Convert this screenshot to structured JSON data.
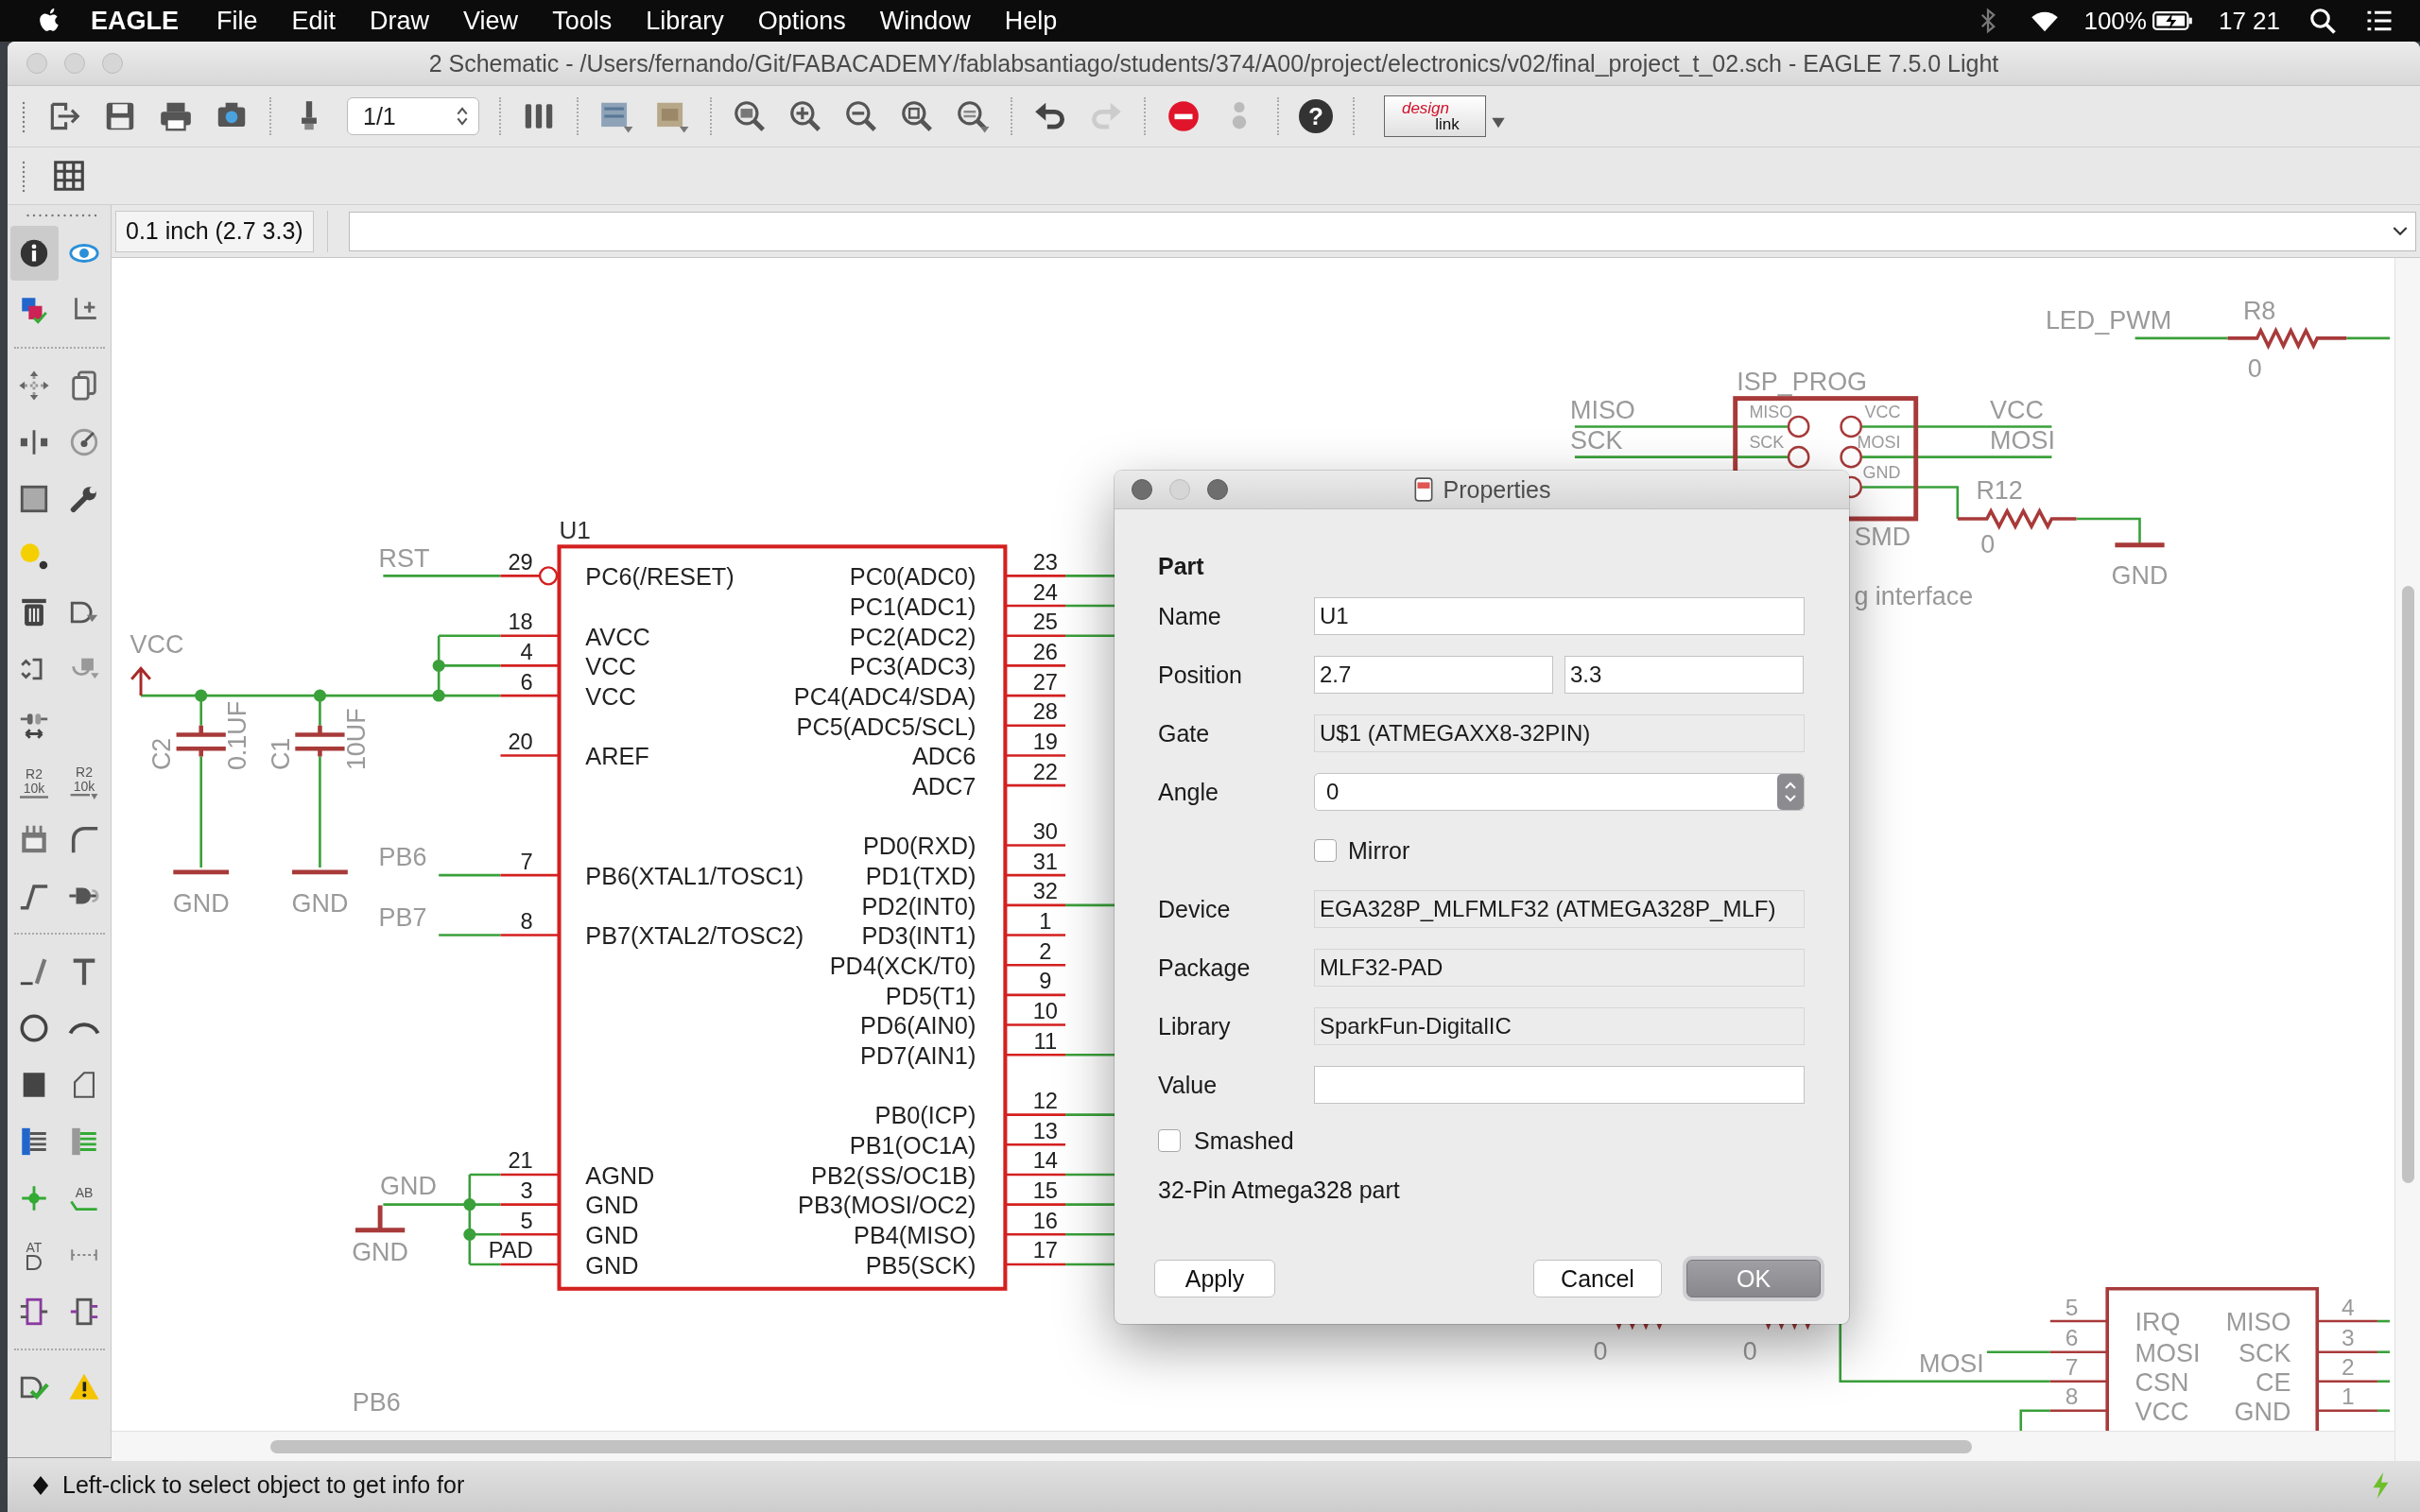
{
  "menu_bar": {
    "app": "EAGLE",
    "items": [
      "File",
      "Edit",
      "Draw",
      "View",
      "Tools",
      "Library",
      "Options",
      "Window",
      "Help"
    ],
    "battery": "100%",
    "clock": "17 21"
  },
  "window": {
    "title": "2 Schematic - /Users/fernando/Git/FABACADEMY/fablabsantiago/students/374/A00/project/electronics/v02/final_project_t_02.sch - EAGLE 7.5.0 Light"
  },
  "toolbar": {
    "page": "1/1",
    "help": "?",
    "design_link": [
      "design",
      "link"
    ]
  },
  "left_tools": [
    {
      "selected": true
    },
    {
      "selected": false
    },
    {
      "selected": false
    },
    {
      "selected": false
    },
    {
      "selected": false
    },
    {
      "selected": false
    },
    {
      "selected": false
    },
    {
      "selected": false
    },
    {
      "selected": false
    },
    {
      "selected": false
    },
    {
      "selected": false
    },
    {
      "selected": false
    },
    {
      "selected": false
    },
    {
      "selected": false
    },
    {
      "selected": false
    },
    {
      "selected": false
    },
    {
      "selected": false,
      "caption": [
        "R2",
        "10k"
      ]
    },
    {
      "selected": false,
      "caption": [
        "R2",
        "10k"
      ]
    },
    {
      "selected": false
    },
    {
      "selected": false
    },
    {
      "selected": false
    },
    {
      "selected": false
    },
    {
      "selected": false
    },
    {
      "selected": false
    },
    {
      "selected": false
    },
    {
      "selected": false
    },
    {
      "selected": false
    },
    {
      "selected": false
    },
    {
      "selected": false
    },
    {
      "selected": false
    },
    {
      "selected": false
    },
    {
      "selected": false,
      "caption": [
        "AB"
      ]
    },
    {
      "selected": false,
      "caption": [
        "AT"
      ]
    },
    {
      "selected": false
    },
    {
      "selected": false
    },
    {
      "selected": false
    },
    {
      "selected": false
    },
    {
      "selected": false
    }
  ],
  "command_bar": {
    "coordinate": "0.1 inch (2.7 3.3)"
  },
  "schematic": {
    "u1": {
      "name": "U1",
      "left_pins": [
        {
          "number": "29",
          "name": "PC6(/RESET)"
        },
        {
          "number": "18",
          "name": "AVCC"
        },
        {
          "number": "4",
          "name": "VCC"
        },
        {
          "number": "6",
          "name": "VCC"
        },
        {
          "number": "20",
          "name": "AREF"
        },
        {
          "number": "7",
          "name": "PB6(XTAL1/TOSC1)"
        },
        {
          "number": "8",
          "name": "PB7(XTAL2/TOSC2)"
        },
        {
          "number": "21",
          "name": "AGND"
        },
        {
          "number": "3",
          "name": "GND"
        },
        {
          "number": "5",
          "name": "GND"
        },
        {
          "number": "PAD",
          "name": "GND"
        }
      ],
      "right_pins": [
        {
          "number": "23",
          "name": "PC0(ADC0)"
        },
        {
          "number": "24",
          "name": "PC1(ADC1)"
        },
        {
          "number": "25",
          "name": "PC2(ADC2)"
        },
        {
          "number": "26",
          "name": "PC3(ADC3)"
        },
        {
          "number": "27",
          "name": "PC4(ADC4/SDA)"
        },
        {
          "number": "28",
          "name": "PC5(ADC5/SCL)"
        },
        {
          "number": "19",
          "name": "ADC6"
        },
        {
          "number": "22",
          "name": "ADC7"
        },
        {
          "number": "30",
          "name": "PD0(RXD)"
        },
        {
          "number": "31",
          "name": "PD1(TXD)"
        },
        {
          "number": "32",
          "name": "PD2(INT0)"
        },
        {
          "number": "1",
          "name": "PD3(INT1)"
        },
        {
          "number": "2",
          "name": "PD4(XCK/T0)"
        },
        {
          "number": "9",
          "name": "PD5(T1)"
        },
        {
          "number": "10",
          "name": "PD6(AIN0)"
        },
        {
          "number": "11",
          "name": "PD7(AIN1)"
        },
        {
          "number": "12",
          "name": "PB0(ICP)"
        },
        {
          "number": "13",
          "name": "PB1(OC1A)"
        },
        {
          "number": "14",
          "name": "PB2(SS/OC1B)"
        },
        {
          "number": "15",
          "name": "PB3(MOSI/OC2)"
        },
        {
          "number": "16",
          "name": "PB4(MISO)"
        },
        {
          "number": "17",
          "name": "PB5(SCK)"
        }
      ]
    },
    "net_labels": [
      "RST",
      "PB6",
      "PB7",
      "GND",
      "PB6",
      "LED_PWM",
      "MISO",
      "SCK",
      "VCC",
      "MOSI",
      "MOSI"
    ],
    "supplies": [
      "VCC",
      "GND",
      "GND",
      "GND",
      "GND"
    ],
    "capacitors": [
      {
        "name": "C2",
        "value": "0.1UF"
      },
      {
        "name": "C1",
        "value": "10UF"
      }
    ],
    "resistors": [
      {
        "name": "R8",
        "value": "0"
      },
      {
        "name": "R12",
        "value": "0"
      },
      {
        "value": "0"
      },
      {
        "value": "0"
      }
    ],
    "isp_header": {
      "name": "ISP_PROG",
      "pins": [
        "MISO",
        "SCK",
        "VCC",
        "MOSI",
        "GND"
      ],
      "package": "SMD",
      "note": "g interface"
    },
    "radio_module": {
      "left_pins": [
        {
          "number": "5",
          "name": "IRQ"
        },
        {
          "number": "6",
          "name": "MOSI"
        },
        {
          "number": "7",
          "name": "CSN"
        },
        {
          "number": "8",
          "name": "VCC"
        }
      ],
      "right_pins": [
        {
          "number": "4",
          "name": "MISO"
        },
        {
          "number": "3",
          "name": "SCK"
        },
        {
          "number": "2",
          "name": "CE"
        },
        {
          "number": "1",
          "name": "GND"
        }
      ]
    }
  },
  "properties_dialog": {
    "title": "Properties",
    "section": "Part",
    "fields": [
      {
        "label": "Name",
        "kind": "text",
        "value": "U1"
      },
      {
        "label": "Position",
        "kind": "pair",
        "values": [
          "2.7",
          "3.3"
        ]
      },
      {
        "label": "Gate",
        "kind": "readonly",
        "value": "U$1 (ATMEGAXX8-32PIN)"
      },
      {
        "label": "Angle",
        "kind": "spinner",
        "value": "0"
      },
      {
        "label": "Mirror",
        "kind": "checkbox",
        "checked": false
      },
      {
        "label": "Device",
        "kind": "readonly",
        "value": "EGA328P_MLFMLF32 (ATMEGA328P_MLF)"
      },
      {
        "label": "Package",
        "kind": "readonly",
        "value": "MLF32-PAD"
      },
      {
        "label": "Library",
        "kind": "readonly",
        "value": "SparkFun-DigitalIC"
      },
      {
        "label": "Value",
        "kind": "text"
      }
    ],
    "smashed": {
      "label": "Smashed",
      "checked": false
    },
    "description": "32-Pin Atmega328 part",
    "buttons": [
      {
        "label": "Apply",
        "kind": "normal"
      },
      {
        "label": "Cancel",
        "kind": "normal"
      },
      {
        "label": "OK",
        "kind": "default"
      }
    ]
  },
  "status_bar": {
    "message": "Left-click to select object to get info for"
  }
}
